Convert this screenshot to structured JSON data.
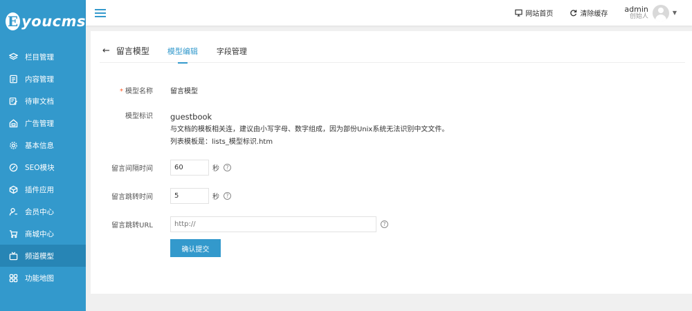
{
  "brand": {
    "mark": "E",
    "name": "youcms"
  },
  "colors": {
    "accent": "#3399cc",
    "sidebar_active": "#2785b5",
    "required": "#ff5722"
  },
  "sidebar": {
    "items": [
      {
        "label": "栏目管理",
        "icon": "layers-icon"
      },
      {
        "label": "内容管理",
        "icon": "document-icon"
      },
      {
        "label": "待审文档",
        "icon": "edit-doc-icon"
      },
      {
        "label": "广告管理",
        "icon": "ad-icon"
      },
      {
        "label": "基本信息",
        "icon": "gear-icon"
      },
      {
        "label": "SEO模块",
        "icon": "seo-icon"
      },
      {
        "label": "插件应用",
        "icon": "box-icon"
      },
      {
        "label": "会员中心",
        "icon": "user-icon"
      },
      {
        "label": "商城中心",
        "icon": "cart-icon"
      },
      {
        "label": "频道模型",
        "icon": "tv-icon",
        "active": true
      },
      {
        "label": "功能地图",
        "icon": "grid-icon"
      }
    ]
  },
  "topbar": {
    "site_home": "网站首页",
    "clear_cache": "清除缓存",
    "user_name": "admin",
    "user_role": "创始人"
  },
  "tabs": {
    "back_label": "留言模型",
    "items": [
      {
        "label": "模型编辑",
        "active": true
      },
      {
        "label": "字段管理",
        "active": false
      }
    ]
  },
  "form": {
    "model_name_label": "模型名称",
    "model_name_value": "留言模型",
    "model_id_label": "模型标识",
    "model_id_value": "guestbook",
    "model_id_hint1": "与文档的模板相关连，建议由小写字母、数字组成，因为部份Unix系统无法识别中文文件。",
    "model_id_hint2": "列表模板是：lists_模型标识.htm",
    "interval_label": "留言间隔时间",
    "interval_value": "60",
    "interval_unit": "秒",
    "jump_time_label": "留言跳转时间",
    "jump_time_value": "5",
    "jump_time_unit": "秒",
    "jump_url_label": "留言跳转URL",
    "jump_url_placeholder": "http://",
    "submit_label": "确认提交"
  }
}
